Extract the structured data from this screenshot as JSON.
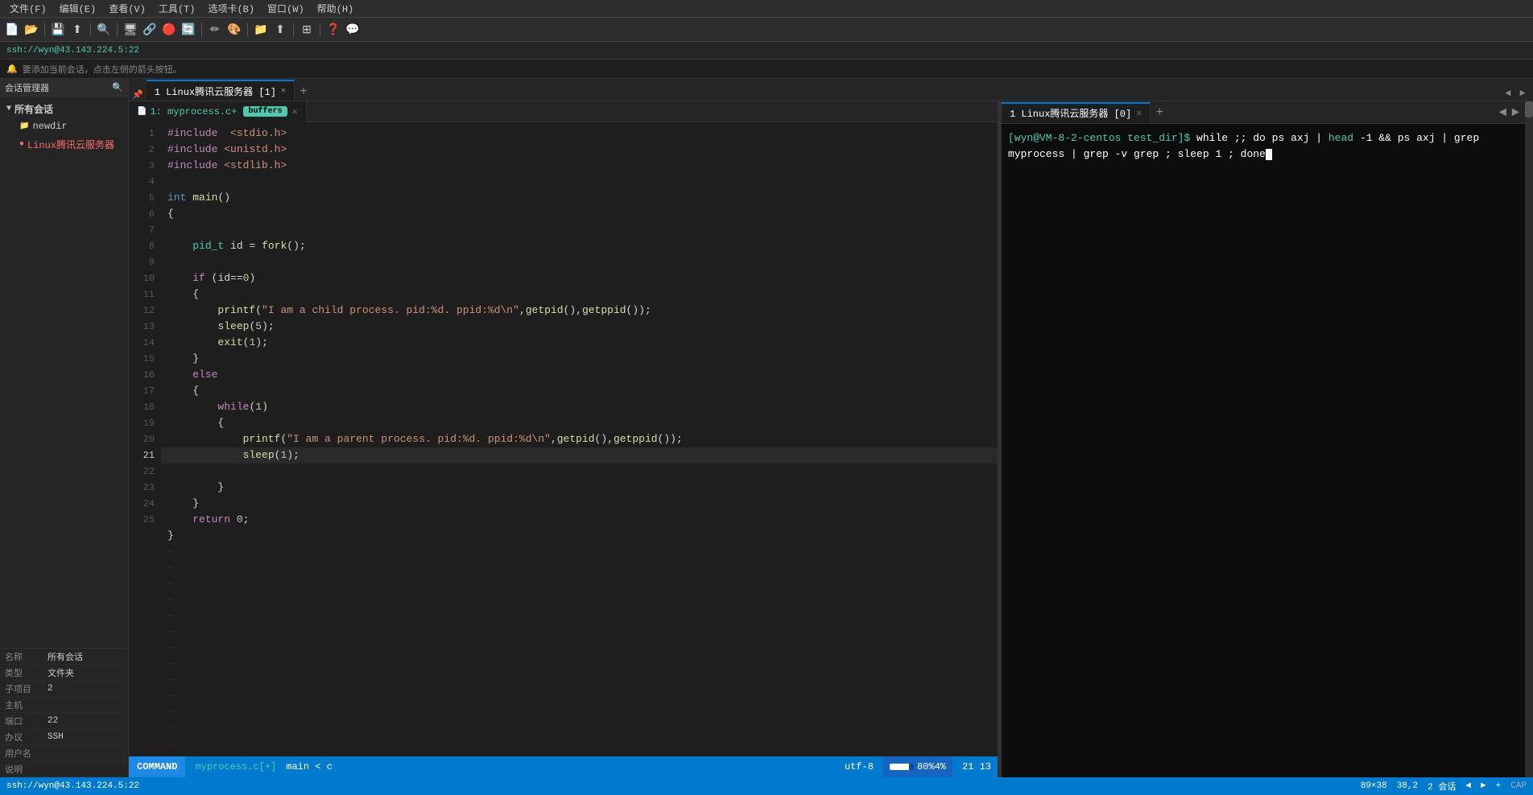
{
  "menubar": {
    "items": [
      "文件(F)",
      "编辑(E)",
      "查看(V)",
      "工具(T)",
      "选项卡(B)",
      "窗口(W)",
      "帮助(H)"
    ]
  },
  "sessionbar": {
    "text": "ssh://wyn@43.143.224.5:22"
  },
  "promptbar": {
    "text": "要添加当前会话，点击左侧的箭头按钮。"
  },
  "sidebar": {
    "header": "会话管理器",
    "items": [
      {
        "label": "所有会话",
        "level": "top",
        "icon": "▼"
      },
      {
        "label": "newdir",
        "level": "sub",
        "icon": "📁"
      },
      {
        "label": "Linux腾讯云服务器",
        "level": "sub",
        "icon": "●",
        "type": "server"
      }
    ],
    "properties": {
      "name_label": "名称",
      "name_val": "所有会话",
      "type_label": "类型",
      "type_val": "文件夹",
      "child_label": "子项目",
      "child_val": "2",
      "host_label": "主机",
      "host_val": "",
      "port_label": "端口",
      "port_val": "22",
      "action_label": "办议",
      "action_val": "SSH",
      "user_label": "用户名",
      "user_val": "",
      "note_label": "说明",
      "note_val": ""
    }
  },
  "editor": {
    "tab_label": "1 Linux腾讯云服务器 [1]",
    "file_tab": "1: myprocess.c+",
    "buffers_label": "buffers",
    "code_lines": [
      {
        "num": 1,
        "text": "#include  <stdio.h>",
        "type": "include"
      },
      {
        "num": 2,
        "text": "#include <unistd.h>",
        "type": "include"
      },
      {
        "num": 3,
        "text": "#include <stdlib.h>",
        "type": "include"
      },
      {
        "num": 4,
        "text": "",
        "type": "blank"
      },
      {
        "num": 5,
        "text": "int main()",
        "type": "code"
      },
      {
        "num": 6,
        "text": "{",
        "type": "code"
      },
      {
        "num": 7,
        "text": "",
        "type": "blank"
      },
      {
        "num": 8,
        "text": "    pid_t id = fork();",
        "type": "code"
      },
      {
        "num": 9,
        "text": "",
        "type": "blank"
      },
      {
        "num": 10,
        "text": "    if (id==0)",
        "type": "code"
      },
      {
        "num": 11,
        "text": "    {",
        "type": "code"
      },
      {
        "num": 12,
        "text": "        printf(\"I am a child process. pid:%d. ppid:%d\\n\",getpid(),getppid());",
        "type": "code"
      },
      {
        "num": 13,
        "text": "        sleep(5);",
        "type": "code"
      },
      {
        "num": 14,
        "text": "        exit(1);",
        "type": "code"
      },
      {
        "num": 15,
        "text": "    }",
        "type": "code"
      },
      {
        "num": 16,
        "text": "    else",
        "type": "code"
      },
      {
        "num": 17,
        "text": "    {",
        "type": "code"
      },
      {
        "num": 18,
        "text": "        while(1)",
        "type": "code"
      },
      {
        "num": 19,
        "text": "        {",
        "type": "code"
      },
      {
        "num": 20,
        "text": "            printf(\"I am a parent process. pid:%d. ppid:%d\\n\",getpid(),getppid());",
        "type": "code"
      },
      {
        "num": 21,
        "text": "            sleep(1);",
        "type": "hl",
        "highlight": true
      },
      {
        "num": 22,
        "text": "        }",
        "type": "code"
      },
      {
        "num": 23,
        "text": "    }",
        "type": "code"
      },
      {
        "num": 24,
        "text": "    return 0;",
        "type": "code"
      },
      {
        "num": 25,
        "text": "}",
        "type": "code"
      }
    ],
    "status": {
      "mode": "COMMAND",
      "file": "myprocess.c[+]",
      "branch": "main < c",
      "encoding": "utf-8",
      "progress": "80%4%",
      "position": "21 13"
    }
  },
  "terminal": {
    "tab_label": "1 Linux腾讯云服务器 [0]",
    "content_line1": "[wyn@VM-8-2-centos test_dir]$ while ;; do ps axj | head -1 && ps axj | grep myprocess | grep -v grep ; sleep 1 ; done"
  },
  "bottom_status": {
    "session": "ssh://wyn@43.143.224.5:22",
    "dimensions": "89×38",
    "position": "38,2",
    "sessions": "2 会话",
    "nav_prev": "◄",
    "nav_next": "►",
    "nav_add": "+",
    "caps": "CAP"
  }
}
